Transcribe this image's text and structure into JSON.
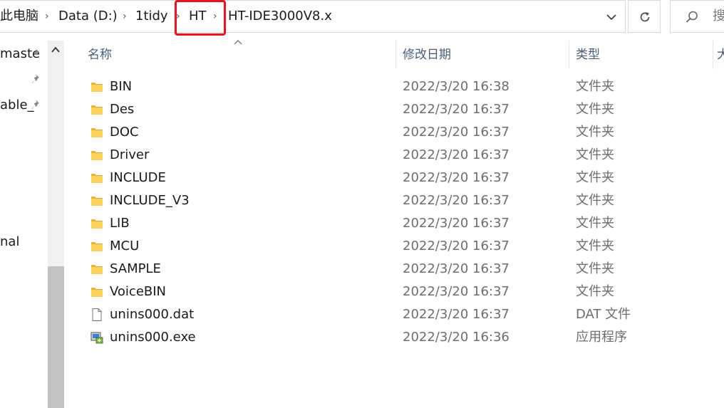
{
  "breadcrumb": {
    "items": [
      "此电脑",
      "Data (D:)",
      "1tidy",
      "HT",
      "HT-IDE3000V8.x"
    ],
    "separator": "›"
  },
  "search": {
    "placeholder": "搜"
  },
  "nav": {
    "items": [
      "maste",
      "able_",
      "nal"
    ]
  },
  "columns": {
    "name": "名称",
    "date": "修改日期",
    "type": "类型",
    "size": "大"
  },
  "files": [
    {
      "name": "BIN",
      "date": "2022/3/20 16:38",
      "type": "文件夹",
      "icon": "folder-icon"
    },
    {
      "name": "Des",
      "date": "2022/3/20 16:37",
      "type": "文件夹",
      "icon": "folder-icon"
    },
    {
      "name": "DOC",
      "date": "2022/3/20 16:37",
      "type": "文件夹",
      "icon": "folder-icon"
    },
    {
      "name": "Driver",
      "date": "2022/3/20 16:37",
      "type": "文件夹",
      "icon": "folder-icon"
    },
    {
      "name": "INCLUDE",
      "date": "2022/3/20 16:37",
      "type": "文件夹",
      "icon": "folder-icon"
    },
    {
      "name": "INCLUDE_V3",
      "date": "2022/3/20 16:37",
      "type": "文件夹",
      "icon": "folder-icon"
    },
    {
      "name": "LIB",
      "date": "2022/3/20 16:37",
      "type": "文件夹",
      "icon": "folder-icon"
    },
    {
      "name": "MCU",
      "date": "2022/3/20 16:37",
      "type": "文件夹",
      "icon": "folder-icon"
    },
    {
      "name": "SAMPLE",
      "date": "2022/3/20 16:37",
      "type": "文件夹",
      "icon": "folder-icon"
    },
    {
      "name": "VoiceBIN",
      "date": "2022/3/20 16:37",
      "type": "文件夹",
      "icon": "folder-icon"
    },
    {
      "name": "unins000.dat",
      "date": "2022/3/20 16:37",
      "type": "DAT 文件",
      "icon": "document-icon"
    },
    {
      "name": "unins000.exe",
      "date": "2022/3/20 16:36",
      "type": "应用程序",
      "icon": "installer-icon"
    }
  ],
  "colors": {
    "highlight": "#e8131b",
    "folder": "#f5c542",
    "header_text": "#4a5d78",
    "date_text": "#6d6d6d"
  }
}
